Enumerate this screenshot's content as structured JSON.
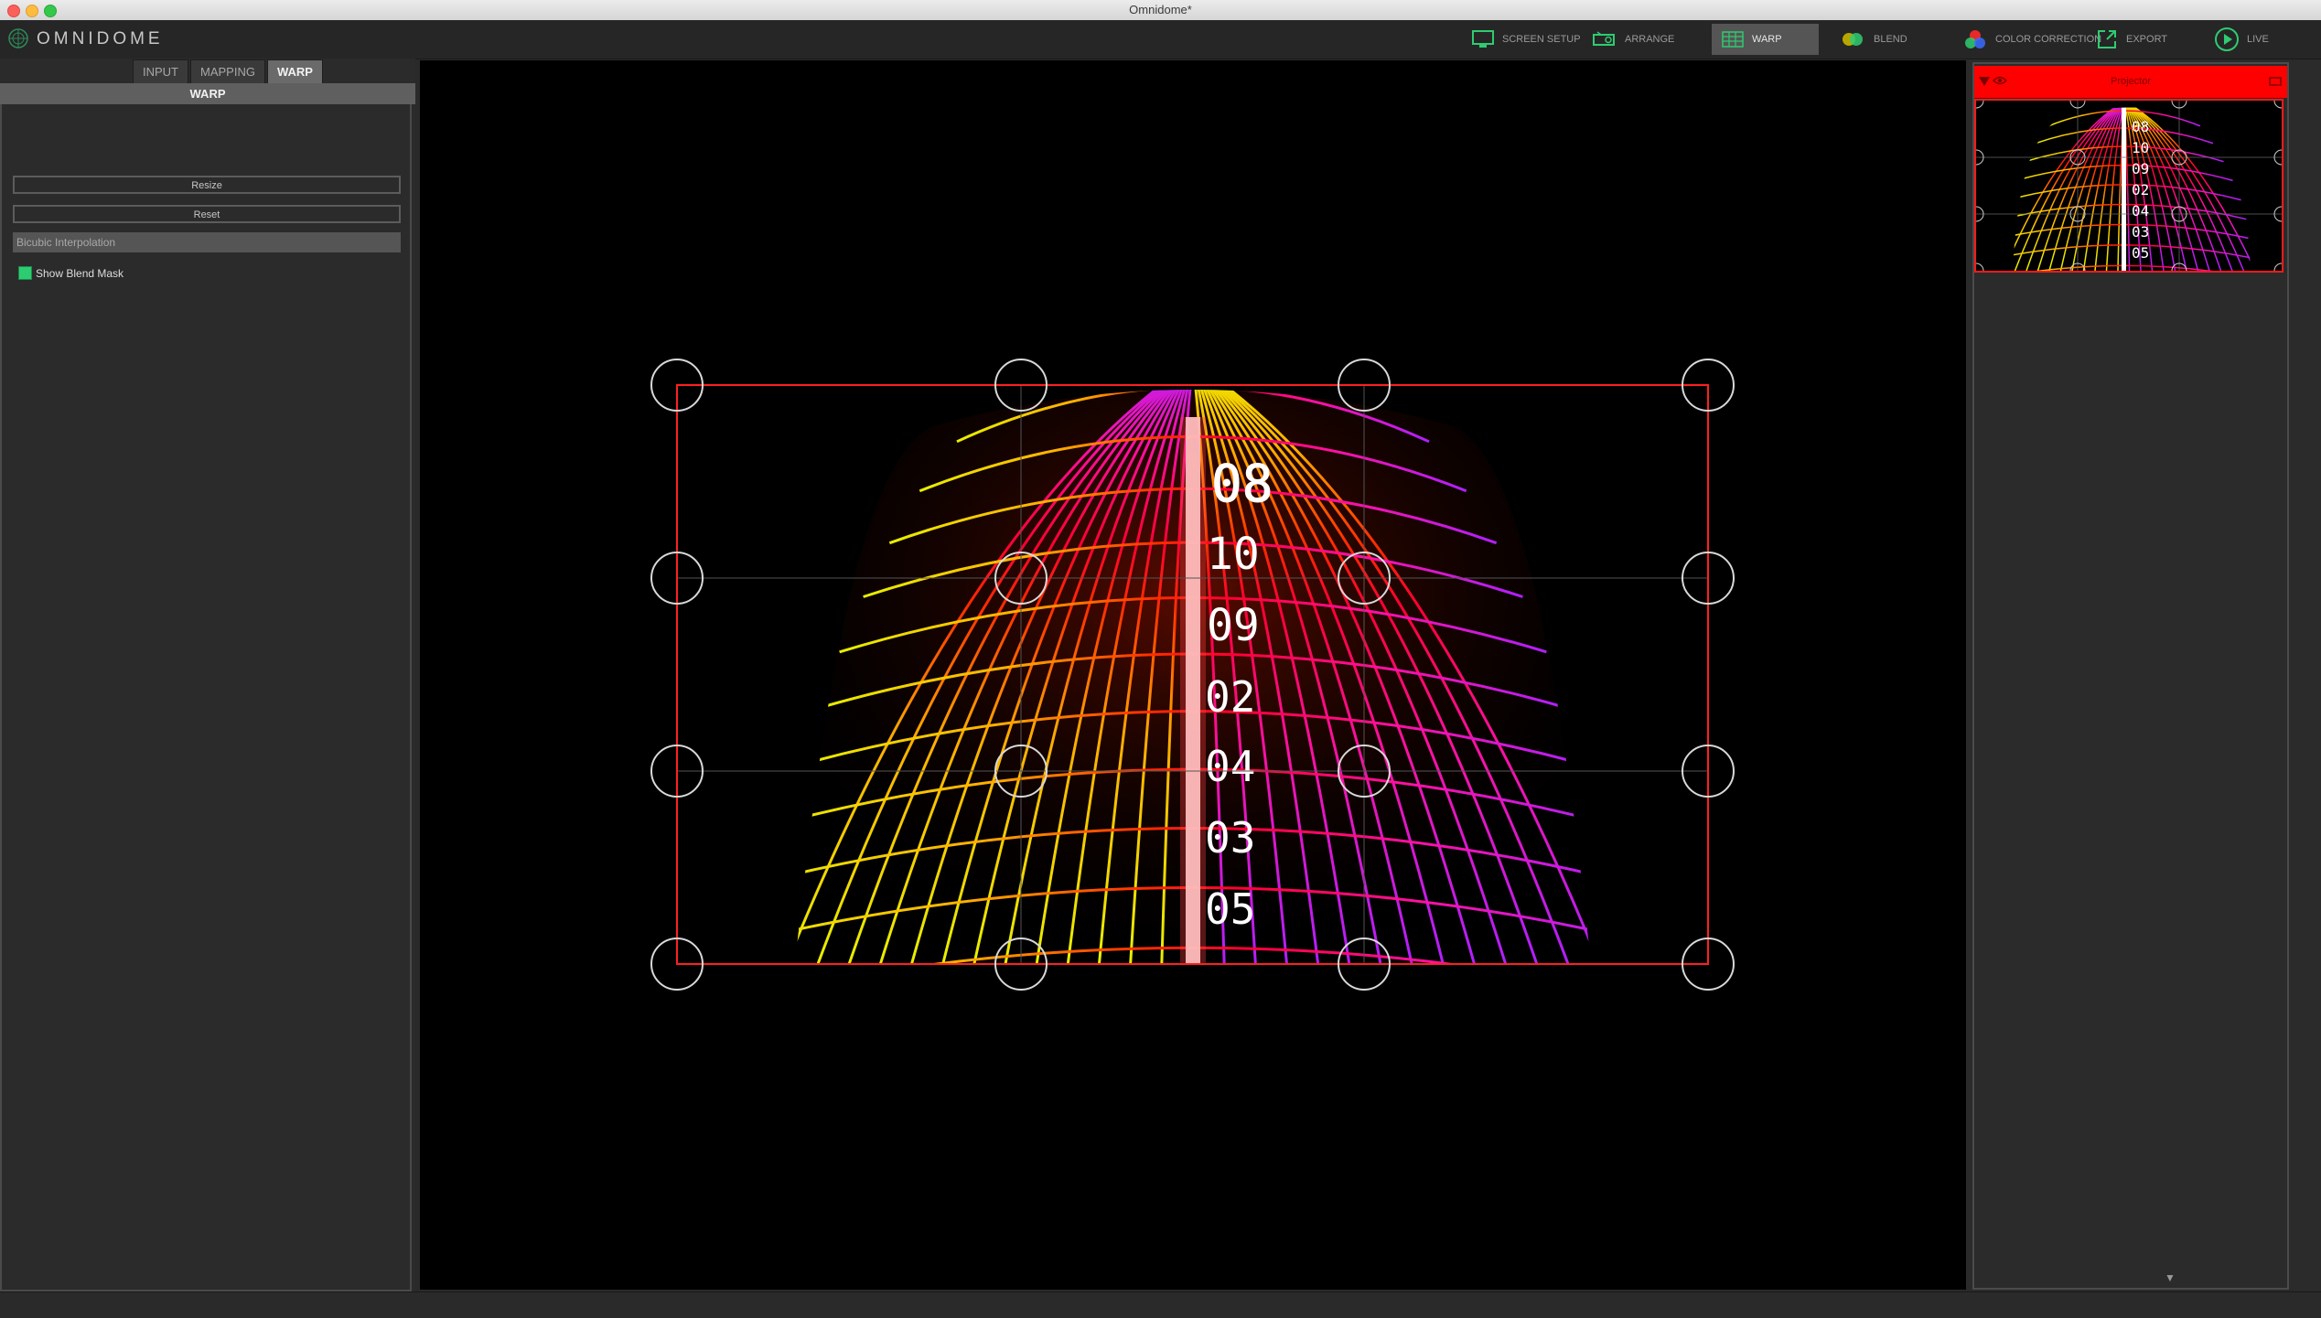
{
  "window": {
    "title": "Omnidome*"
  },
  "app": {
    "name": "OMNIDOME"
  },
  "toolbar": {
    "items": [
      {
        "label": "SCREEN SETUP",
        "icon": "monitor-icon",
        "active": false
      },
      {
        "label": "ARRANGE",
        "icon": "projector-icon",
        "active": false
      },
      {
        "label": "WARP",
        "icon": "grid-icon",
        "active": true
      },
      {
        "label": "BLEND",
        "icon": "circles-icon",
        "active": false
      },
      {
        "label": "COLOR CORRECTION",
        "icon": "rgb-circles-icon",
        "active": false
      },
      {
        "label": "EXPORT",
        "icon": "export-icon",
        "active": false
      },
      {
        "label": "LIVE",
        "icon": "play-icon",
        "active": false
      }
    ]
  },
  "tabs": [
    {
      "label": "INPUT",
      "active": false
    },
    {
      "label": "MAPPING",
      "active": false
    },
    {
      "label": "WARP",
      "active": true
    }
  ],
  "warp": {
    "header": "WARP",
    "resize_label": "Resize",
    "reset_label": "Reset",
    "interpolation": "Bicubic Interpolation",
    "show_blend_mask_label": "Show Blend Mask",
    "show_blend_mask": true
  },
  "canvas": {
    "labels": [
      "08",
      "10",
      "09",
      "02",
      "04",
      "03",
      "05"
    ],
    "grid_size": "4x4"
  },
  "projector": {
    "title": "Projector",
    "header_color": "#ff0000",
    "labels": [
      "08",
      "10",
      "09",
      "02",
      "04",
      "03",
      "05"
    ]
  },
  "colors": {
    "accent_green": "#2ecc71",
    "warp_border": "#ff2020",
    "active_tab": "#6a6a6a"
  }
}
